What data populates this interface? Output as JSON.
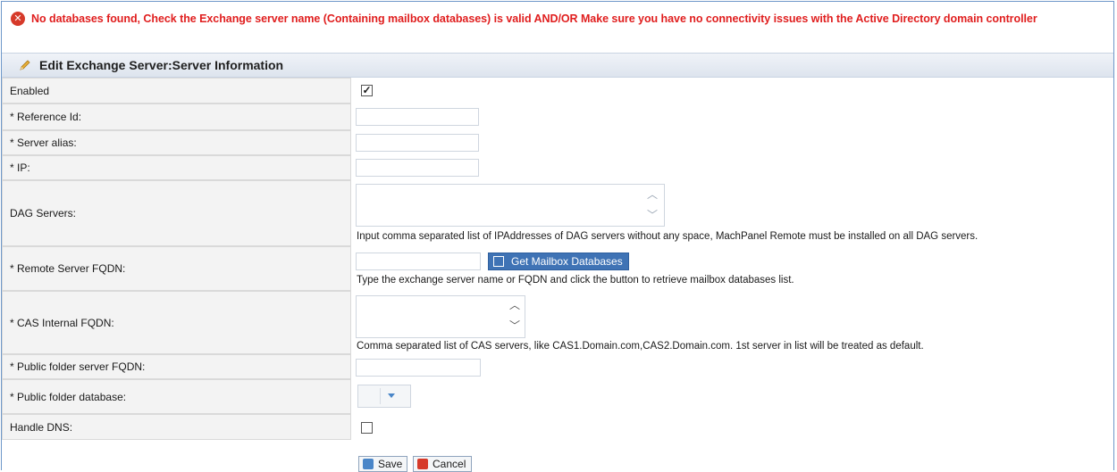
{
  "error": {
    "message": "No databases found, Check the Exchange server name (Containing mailbox databases) is valid AND/OR Make sure you have no connectivity issues with the Active Directory domain controller",
    "icon": "error-icon",
    "color": "#e01e1e"
  },
  "section": {
    "title": "Edit Exchange Server:Server Information",
    "icon": "pencil-icon"
  },
  "form": {
    "enabled": {
      "label": "Enabled",
      "checked": true,
      "mark": "✓"
    },
    "reference_id": {
      "label": "* Reference Id:",
      "value": ""
    },
    "server_alias": {
      "label": "* Server alias:",
      "value": ""
    },
    "ip": {
      "label": "* IP:",
      "value": ""
    },
    "dag_servers": {
      "label": "DAG Servers:",
      "value": "",
      "hint": "Input comma separated list of IPAddresses of DAG servers without any space, MachPanel Remote must be installed on all DAG servers."
    },
    "remote_fqdn": {
      "label": "* Remote Server FQDN:",
      "value": "",
      "button": "Get Mailbox Databases",
      "hint": "Type the exchange server name or FQDN and click the button to retrieve mailbox databases list."
    },
    "cas_fqdn": {
      "label": "* CAS Internal FQDN:",
      "value": "",
      "hint": "Comma separated list of CAS servers, like CAS1.Domain.com,CAS2.Domain.com. 1st server in list will be treated as default."
    },
    "public_folder_fqdn": {
      "label": "* Public folder server FQDN:",
      "value": ""
    },
    "public_folder_db": {
      "label": "* Public folder database:",
      "selected": ""
    },
    "handle_dns": {
      "label": "Handle DNS:",
      "checked": false
    }
  },
  "actions": {
    "save": "Save",
    "cancel": "Cancel"
  },
  "colors": {
    "accent": "#3f73b5",
    "frame": "#6d97c9",
    "label_bg": "#f3f3f3"
  }
}
